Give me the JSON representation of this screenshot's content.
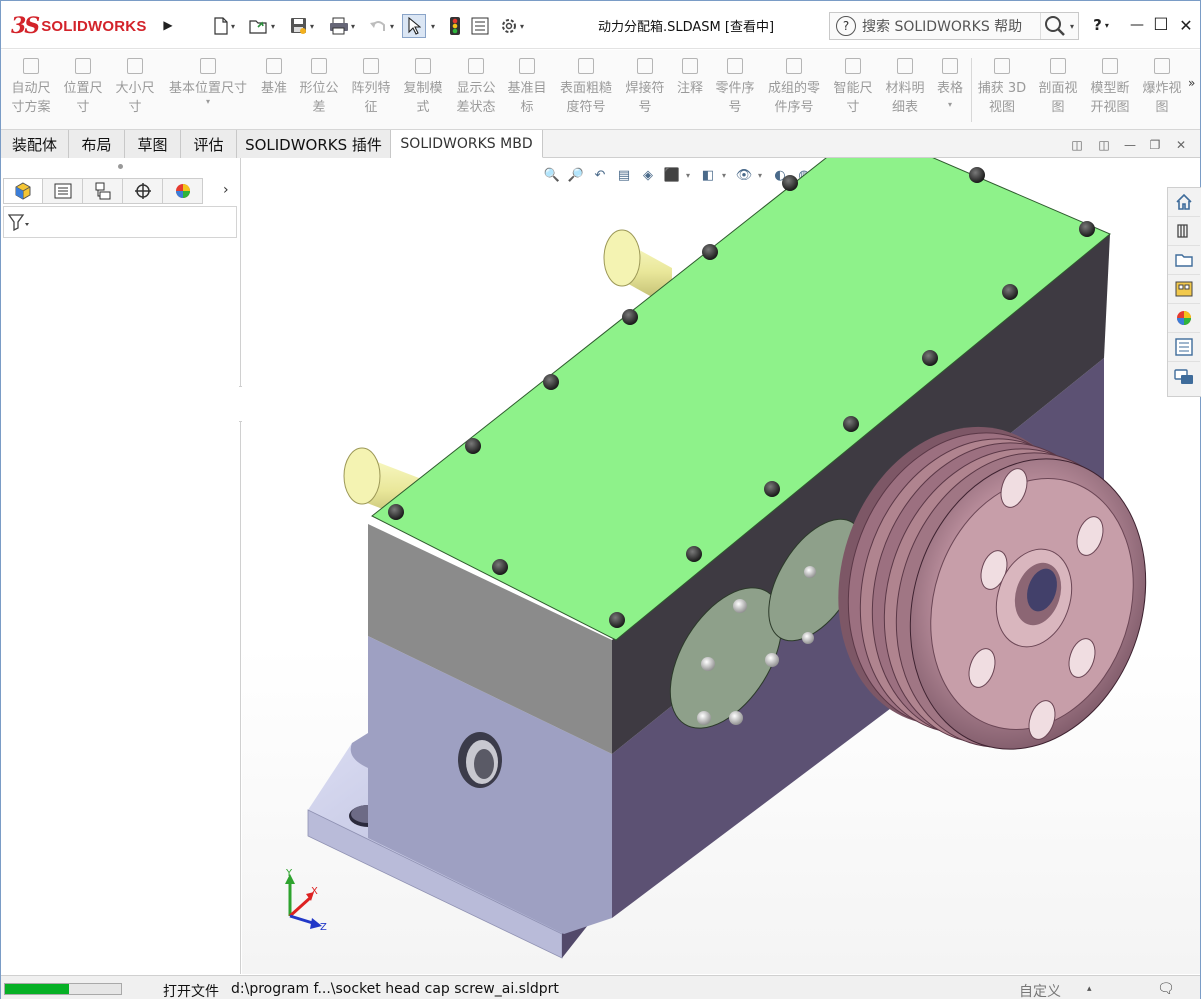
{
  "app": {
    "brand_mark": "3S",
    "brand_name": "SOLIDWORKS",
    "document_title": "动力分配箱.SLDASM [查看中]"
  },
  "quick_access": {
    "new": "new-document-icon",
    "open": "open-icon",
    "save": "save-icon",
    "print": "print-icon",
    "undo": "undo-icon",
    "select": "select-cursor-icon",
    "rebuild": "traffic-light-icon",
    "file_props": "file-properties-icon",
    "options": "gear-icon"
  },
  "help": {
    "placeholder": "搜索 SOLIDWORKS 帮助",
    "question": "?"
  },
  "window_controls": {
    "help": "?",
    "minimize": "—",
    "maximize": "☐",
    "close": "✕"
  },
  "commands": [
    {
      "label": "自动尺\n寸方案"
    },
    {
      "label": "位置尺\n寸"
    },
    {
      "label": "大小尺\n寸"
    },
    {
      "label": "基本位置尺寸"
    },
    {
      "label": "基准"
    },
    {
      "label": "形位公\n差"
    },
    {
      "label": "阵列特\n征"
    },
    {
      "label": "复制模\n式"
    },
    {
      "label": "显示公\n差状态"
    },
    {
      "label": "基准目\n标"
    },
    {
      "label": "表面粗糙\n度符号"
    },
    {
      "label": "焊接符\n号"
    },
    {
      "label": "注释"
    },
    {
      "label": "零件序\n号"
    },
    {
      "label": "成组的零\n件序号"
    },
    {
      "label": "智能尺\n寸"
    },
    {
      "label": "材料明\n细表"
    },
    {
      "label": "表格"
    },
    {
      "label": "捕获 3D\n视图"
    },
    {
      "label": "剖面视\n图"
    },
    {
      "label": "模型断\n开视图"
    },
    {
      "label": "爆炸视\n图"
    }
  ],
  "tabs": [
    {
      "label": "装配体"
    },
    {
      "label": "布局"
    },
    {
      "label": "草图"
    },
    {
      "label": "评估"
    },
    {
      "label": "SOLIDWORKS 插件"
    },
    {
      "label": "SOLIDWORKS MBD"
    }
  ],
  "status": {
    "progress": 0.55,
    "label": "打开文件",
    "path": "d:\\program f...\\socket head cap screw_ai.sldprt",
    "custom": "自定义"
  },
  "triad": {
    "x": "X",
    "y": "Y",
    "z": "Z"
  },
  "colors": {
    "brand": "#d3232a",
    "lid": "#8ef28a",
    "body_front": "#9ea0c2",
    "body_side": "#5c5173",
    "pulley": "#b58a98",
    "shaft": "#e9e79a",
    "progress": "#06b025"
  }
}
